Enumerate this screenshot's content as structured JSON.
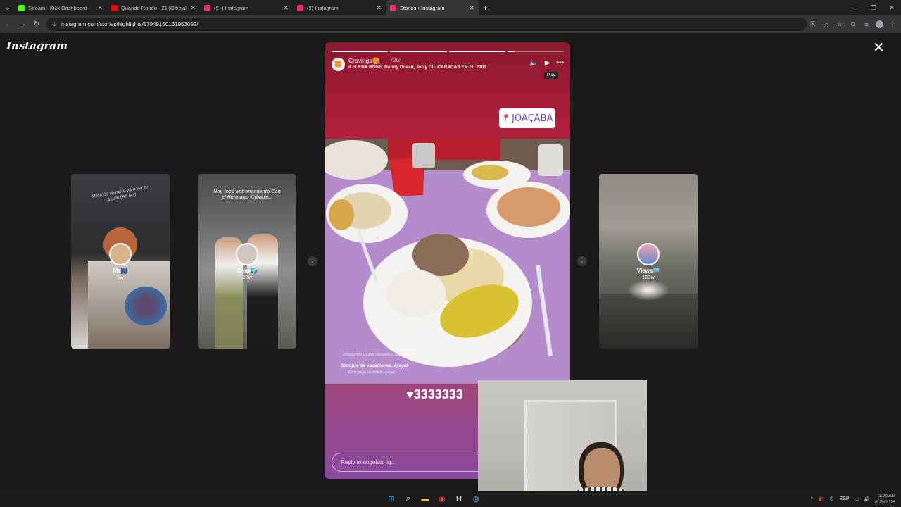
{
  "browser": {
    "tabs": [
      {
        "title": "Stream - Kick Dashboard",
        "favicon_color": "#53fc18",
        "active": false
      },
      {
        "title": "Quando Rondo - 21 [Official Au",
        "favicon_color": "#ff0000",
        "active": false
      },
      {
        "title": "(9+) Instagram",
        "favicon_color": "#e1306c",
        "active": false
      },
      {
        "title": "(9) Instagram",
        "favicon_color": "#e1306c",
        "active": false
      },
      {
        "title": "Stories • Instagram",
        "favicon_color": "#e1306c",
        "active": true
      }
    ],
    "new_tab_symbol": "+",
    "url": "instagram.com/stories/highlights/17949150131953092/"
  },
  "instagram": {
    "logo": "Instagram",
    "side_stories": [
      {
        "name": "Me🎆",
        "time": "5w",
        "art_text": "Millones siempre va a ser tu castillo (Ah Brr)"
      },
      {
        "name": "Crew🌍",
        "time": "22w",
        "art_text": "Hoy toco entrenamiento Con el Hermano @jbarre..."
      },
      {
        "name": "Views🏙️",
        "time": "103w",
        "art_text": ""
      }
    ],
    "story": {
      "highlight_name": "Cravings🍔",
      "age": "72w",
      "music": "ELENA ROSE, Danny Ocean, Jerry Di · CARACAS EN EL 2000",
      "tooltip": "Play",
      "location_sticker": "JOAÇABA",
      "photo_caption_top": "Almorzando los dias\nLlenando la que se hagan",
      "photo_caption_main": "Siempre de vacaciones, ayayai",
      "photo_caption_bottom": "En la playa sin sonido, ayayai",
      "likes_text": "♥3333333",
      "reply_placeholder": "Reply to angelvis_ig..."
    }
  },
  "taskbar": {
    "lang": "ESP",
    "time": "1:20 AM",
    "date": "8/25/2026"
  }
}
